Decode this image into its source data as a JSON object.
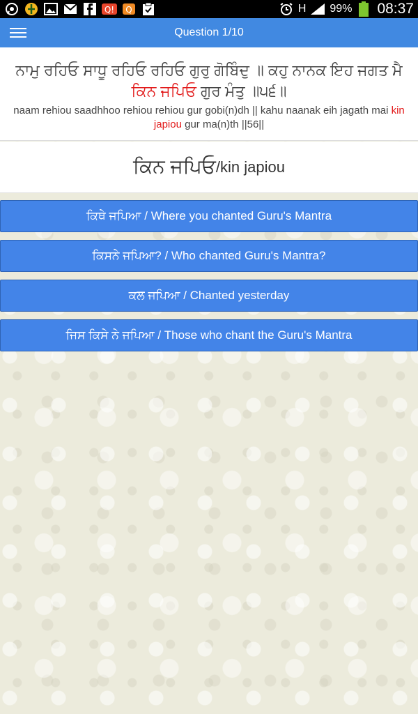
{
  "status_bar": {
    "battery": "99%",
    "time": "08:37",
    "network_type": "H",
    "icons": [
      "whatsapp-icon",
      "khanda-icon",
      "image-icon",
      "gmail-icon",
      "facebook-icon",
      "quiz-badge-icon",
      "quiz-app-icon",
      "clipboard-icon",
      "alarm-icon",
      "signal-icon",
      "battery-icon"
    ]
  },
  "appbar": {
    "title": "Question 1/10"
  },
  "verse": {
    "gurmukhi_before": "ਨਾਮੁ ਰਹਿਓ ਸਾਧੂ ਰਹਿਓ ਰਹਿਓ ਗੁਰੁ ਗੋਬਿੰਦੁ ॥ ਕਹੁ ਨਾਨਕ ਇਹ ਜਗਤ ਮੈ",
    "gurmukhi_highlight": "ਕਿਨ ਜਪਿਓ",
    "gurmukhi_after": "ਗੁਰ ਮੰਤੁ ॥੫੬॥",
    "translit_before": "naam rehiou saadhhoo rehiou rehiou gur gobi(n)dh || kahu naanak eih jagath mai",
    "translit_highlight": "kin japiou",
    "translit_after": "gur ma(n)th ||56||"
  },
  "question": {
    "word": "ਕਿਨ ਜਪਿਓ",
    "separator": " / ",
    "roman": "kin japiou"
  },
  "options": [
    {
      "label": "ਕਿਥੇ ਜਪਿਆ / Where you chanted Guru's Mantra"
    },
    {
      "label": "ਕਿਸਨੇ ਜਪਿਆ? / Who chanted Guru's Mantra?"
    },
    {
      "label": "ਕਲ ਜਪਿਆ / Chanted yesterday"
    },
    {
      "label": "ਜਿਸ ਕਿਸੇ ਨੇ ਜਪਿਆ / Those who chant the Guru's Mantra"
    }
  ],
  "colors": {
    "accent": "#4189e1",
    "option": "#4384e8",
    "highlight": "#e21b1b"
  }
}
